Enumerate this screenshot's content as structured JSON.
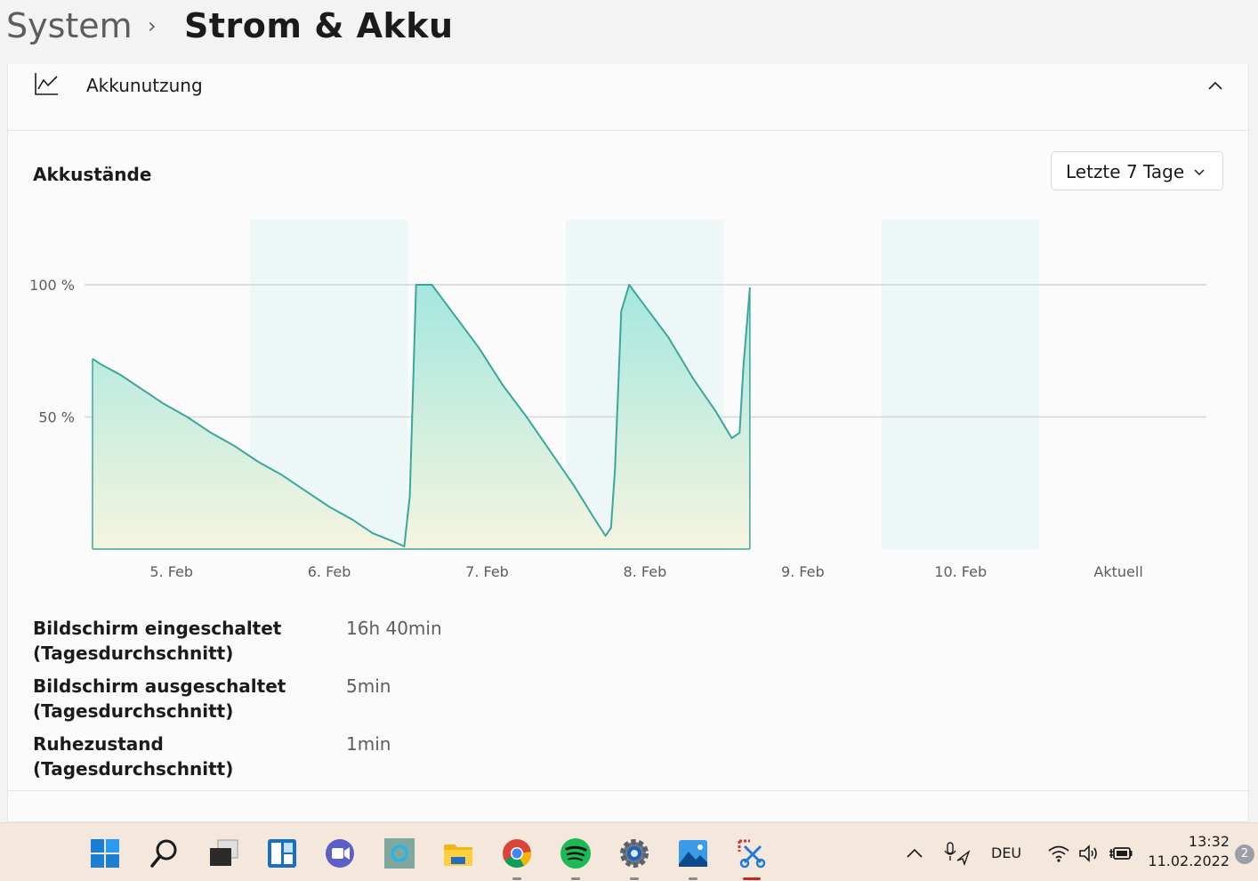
{
  "header": {
    "breadcrumb_parent": "System",
    "breadcrumb_separator": "›",
    "breadcrumb_current": "Strom & Akku"
  },
  "usage_section": {
    "label": "Akkunutzung",
    "icon": "chart-line-icon",
    "collapse_icon": "chevron-up-icon"
  },
  "battery_levels": {
    "title": "Akkustände",
    "period_select": {
      "value": "Letzte 7 Tage",
      "icon": "chevron-down-icon"
    }
  },
  "chart_data": {
    "type": "area",
    "title": "Akkustände",
    "xlabel": "",
    "ylabel": "",
    "ylim": [
      0,
      100
    ],
    "yticks": [
      "100 %",
      "50 %"
    ],
    "ytick_values": [
      100,
      50
    ],
    "categories": [
      "5. Feb",
      "6. Feb",
      "7. Feb",
      "8. Feb",
      "9. Feb",
      "10. Feb",
      "Aktuell"
    ],
    "grid": true,
    "x_unit": "days",
    "series": [
      {
        "values": [
          [
            0,
            72
          ],
          [
            0.1,
            70
          ],
          [
            0.35,
            66
          ],
          [
            0.6,
            61
          ],
          [
            0.9,
            55
          ],
          [
            1.2,
            50
          ],
          [
            1.5,
            44
          ],
          [
            1.8,
            39
          ],
          [
            2.1,
            33
          ],
          [
            2.4,
            28
          ],
          [
            2.7,
            22
          ],
          [
            3.0,
            16
          ],
          [
            3.3,
            11
          ],
          [
            3.55,
            6
          ],
          [
            3.8,
            3
          ],
          [
            3.95,
            1
          ],
          [
            4.02,
            20
          ],
          [
            4.1,
            100
          ],
          [
            4.3,
            100
          ],
          [
            4.6,
            88
          ],
          [
            4.9,
            76
          ],
          [
            5.2,
            62
          ],
          [
            5.5,
            50
          ],
          [
            5.8,
            37
          ],
          [
            6.1,
            24
          ],
          [
            6.35,
            12
          ],
          [
            6.5,
            5
          ],
          [
            6.57,
            8
          ],
          [
            6.62,
            30
          ],
          [
            6.7,
            90
          ],
          [
            6.8,
            100
          ],
          [
            7.0,
            92
          ],
          [
            7.3,
            80
          ],
          [
            7.6,
            65
          ],
          [
            7.9,
            52
          ],
          [
            8.1,
            42
          ],
          [
            8.2,
            44
          ],
          [
            8.25,
            70
          ],
          [
            8.33,
            99
          ]
        ]
      }
    ],
    "shaded_days": [
      1,
      3,
      5
    ],
    "colors": {
      "line": "#3aa79d",
      "fill_top": "#a5e7df",
      "fill_bottom": "#f6f4df",
      "band": "#eef7f7",
      "grid": "#d6d6d6"
    }
  },
  "stats": [
    {
      "label": "Bildschirm eingeschaltet (Tagesdurchschnitt)",
      "value": "16h 40min"
    },
    {
      "label": "Bildschirm ausgeschaltet (Tagesdurchschnitt)",
      "value": "5min"
    },
    {
      "label": "Ruhezustand (Tagesdurchschnitt)",
      "value": "1min"
    }
  ],
  "taskbar": {
    "apps": [
      {
        "name": "start-icon",
        "open": false
      },
      {
        "name": "search-icon",
        "open": false
      },
      {
        "name": "task-view-icon",
        "open": false
      },
      {
        "name": "widgets-icon",
        "open": false
      },
      {
        "name": "teams-chat-icon",
        "open": false
      },
      {
        "name": "app-icon",
        "open": false
      },
      {
        "name": "file-explorer-icon",
        "open": false
      },
      {
        "name": "chrome-icon",
        "open": true
      },
      {
        "name": "spotify-icon",
        "open": true
      },
      {
        "name": "settings-icon",
        "open": true
      },
      {
        "name": "photos-icon",
        "open": true
      },
      {
        "name": "snipping-tool-icon",
        "open": true,
        "active": true
      }
    ],
    "tray": {
      "overflow_icon": "chevron-up-icon",
      "mic_icon": "microphone-location-icon",
      "language": "DEU",
      "wifi_icon": "wifi-icon",
      "volume_icon": "speaker-icon",
      "battery_icon": "battery-charging-icon"
    },
    "clock_time": "13:32",
    "clock_date": "11.02.2022",
    "notification_count": "2"
  }
}
